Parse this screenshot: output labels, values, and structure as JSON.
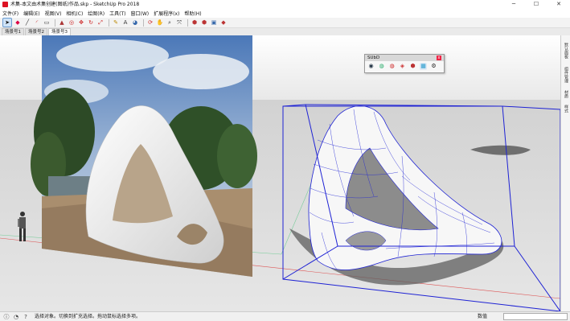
{
  "window": {
    "title": "术集-本文由术集创建(图纸)作品.skp - SketchUp Pro 2018",
    "controls": [
      "─",
      "☐",
      "✕"
    ]
  },
  "menus": [
    "文件(F)",
    "编辑(E)",
    "视图(V)",
    "相机(C)",
    "绘图(R)",
    "工具(T)",
    "窗口(W)",
    "扩展程序(x)",
    "帮助(H)"
  ],
  "scene_tabs": [
    "场景号1",
    "场景号2",
    "场景号3"
  ],
  "active_scene_index": 2,
  "subd_toolbar": {
    "title": "SUbD",
    "close": "x",
    "buttons": [
      "subd-toggle-icon",
      "crease-icon",
      "uncrease-icon",
      "attributes-icon",
      "convert-icon",
      "quadface-icon",
      "settings-icon"
    ]
  },
  "right_tray": [
    "默认面板",
    "组件管理",
    "材质",
    "样式"
  ],
  "status": {
    "message": "选择对象。切换到扩充选择。拖动鼠标选择多项。",
    "measurement_label": "数值",
    "measurement_value": ""
  },
  "colors": {
    "selection_box": "#1e22d4",
    "sky": "#6f98c8",
    "ground": "#d8d8d8",
    "sculpture": "#f4f4f4",
    "shadow": "#6a6a6a"
  }
}
